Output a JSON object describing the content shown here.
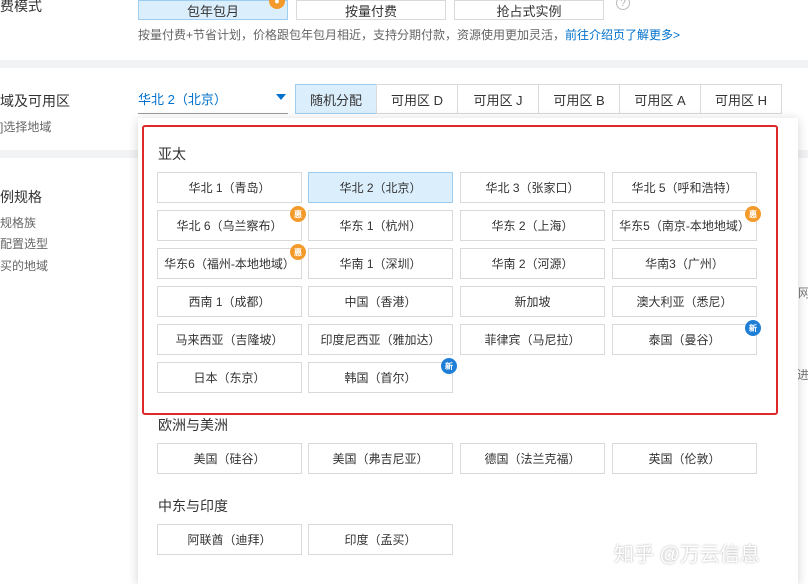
{
  "billing": {
    "left_label": "费模式",
    "buttons": [
      {
        "label": "包年包月",
        "selected": true
      },
      {
        "label": "按量付费",
        "selected": false
      },
      {
        "label": "抢占式实例",
        "selected": false
      }
    ],
    "note": "按量付费+节省计划，价格跟包年包月相近，支持分期付款，资源使用更加灵活，",
    "note_link": "前往介绍页了解更多>"
  },
  "region": {
    "left_label": "域及可用区",
    "left_sub": "]选择地域",
    "selected": "华北 2（北京）",
    "zone_tabs": [
      {
        "label": "随机分配",
        "selected": true
      },
      {
        "label": "可用区 D"
      },
      {
        "label": "可用区 J"
      },
      {
        "label": "可用区 B"
      },
      {
        "label": "可用区 A"
      },
      {
        "label": "可用区 H"
      }
    ]
  },
  "instance": {
    "left_label": "例规格",
    "left_subs": [
      "规格族",
      "配置选型",
      "买的地域"
    ]
  },
  "dropdown": {
    "groups": [
      {
        "title": "亚太",
        "items": [
          {
            "label": "华北 1（青岛）"
          },
          {
            "label": "华北 2（北京）",
            "selected": true
          },
          {
            "label": "华北 3（张家口）"
          },
          {
            "label": "华北 5（呼和浩特）"
          },
          {
            "label": "华北 6（乌兰察布）",
            "badge": "hot"
          },
          {
            "label": "华东 1（杭州）"
          },
          {
            "label": "华东 2（上海）"
          },
          {
            "label": "华东5（南京-本地地域）",
            "badge": "hot"
          },
          {
            "label": "华东6（福州-本地地域）",
            "badge": "hot"
          },
          {
            "label": "华南 1（深圳）"
          },
          {
            "label": "华南 2（河源）"
          },
          {
            "label": "华南3（广州）"
          },
          {
            "label": "西南 1（成都）"
          },
          {
            "label": "中国（香港）"
          },
          {
            "label": "新加坡"
          },
          {
            "label": "澳大利亚（悉尼）"
          },
          {
            "label": "马来西亚（吉隆坡）"
          },
          {
            "label": "印度尼西亚（雅加达）"
          },
          {
            "label": "菲律宾（马尼拉）"
          },
          {
            "label": "泰国（曼谷）",
            "badge": "new"
          },
          {
            "label": "日本（东京）"
          },
          {
            "label": "韩国（首尔）",
            "badge": "new"
          }
        ]
      },
      {
        "title": "欧洲与美洲",
        "items": [
          {
            "label": "美国（硅谷）"
          },
          {
            "label": "美国（弗吉尼亚）"
          },
          {
            "label": "德国（法兰克福）"
          },
          {
            "label": "英国（伦敦）"
          }
        ]
      },
      {
        "title": "中东与印度",
        "items": [
          {
            "label": "阿联酋（迪拜）"
          },
          {
            "label": "印度（孟买）"
          }
        ]
      }
    ],
    "badge_text": {
      "hot": "惠",
      "new": "新"
    }
  },
  "edge": {
    "right_1": "网",
    "right_2": "进"
  },
  "watermark": "知乎 @万云信息",
  "colors": {
    "accent": "#0070cc",
    "selected_bg": "#dbeefb",
    "highlight": "#e02828",
    "hot": "#f39a2b",
    "new": "#1f7fd6"
  }
}
